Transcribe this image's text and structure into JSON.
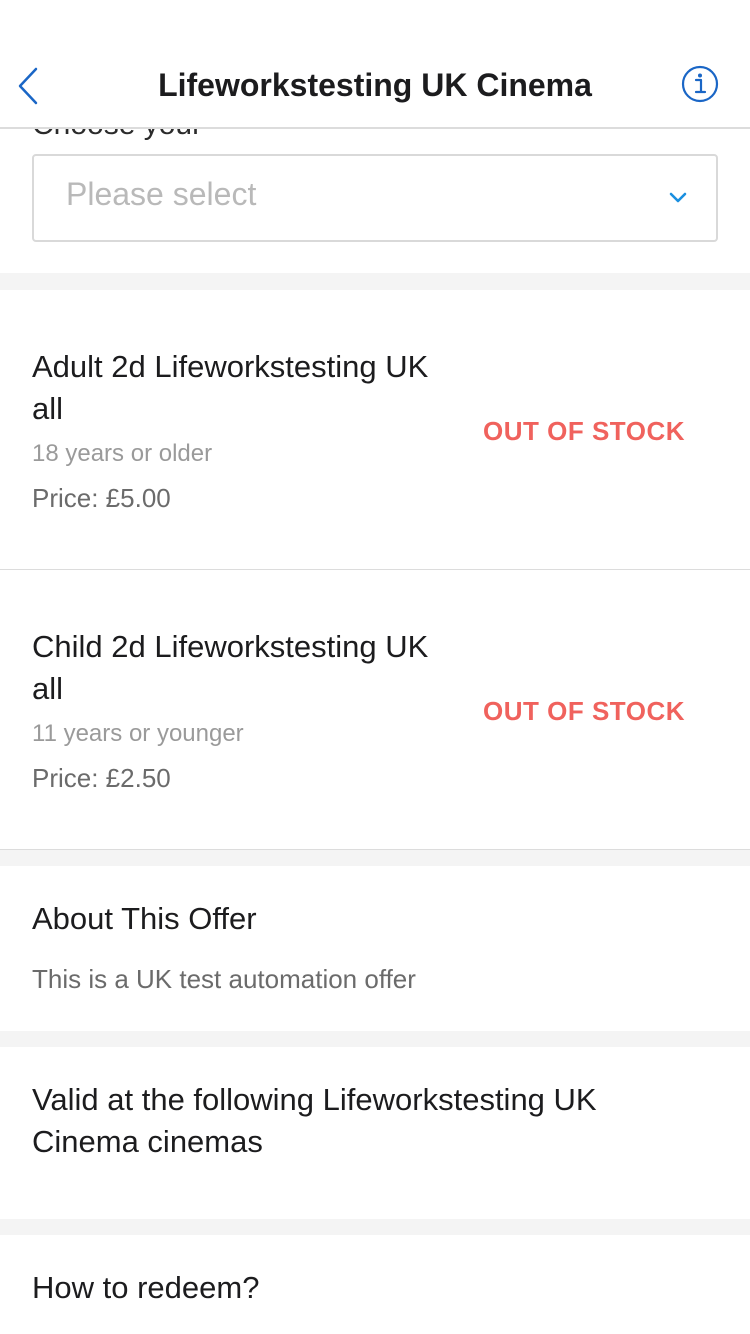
{
  "header": {
    "title": "Lifeworkstesting UK Cinema",
    "back_icon": "chevron-left-icon",
    "info_icon": "info-circle-icon",
    "accent_color": "#1a66c6"
  },
  "selector": {
    "placeholder": "Please select",
    "chevron_icon": "chevron-down-icon",
    "chevron_color": "#1a8fe0"
  },
  "tickets": [
    {
      "name": "Adult 2d Lifeworkstesting UK all",
      "age": "18 years or older",
      "price": "Price: £5.00",
      "status": "OUT OF STOCK"
    },
    {
      "name": "Child 2d Lifeworkstesting UK all",
      "age": "11 years or younger",
      "price": "Price: £2.50",
      "status": "OUT OF STOCK"
    }
  ],
  "about": {
    "title": "About This Offer",
    "body": "This is a UK test automation offer"
  },
  "valid": {
    "title": "Valid at the following Lifeworkstesting UK Cinema cinemas"
  },
  "redeem": {
    "title": "How to redeem?"
  },
  "colors": {
    "out_of_stock": "#f0625d",
    "section_gap": "#f4f4f4"
  }
}
